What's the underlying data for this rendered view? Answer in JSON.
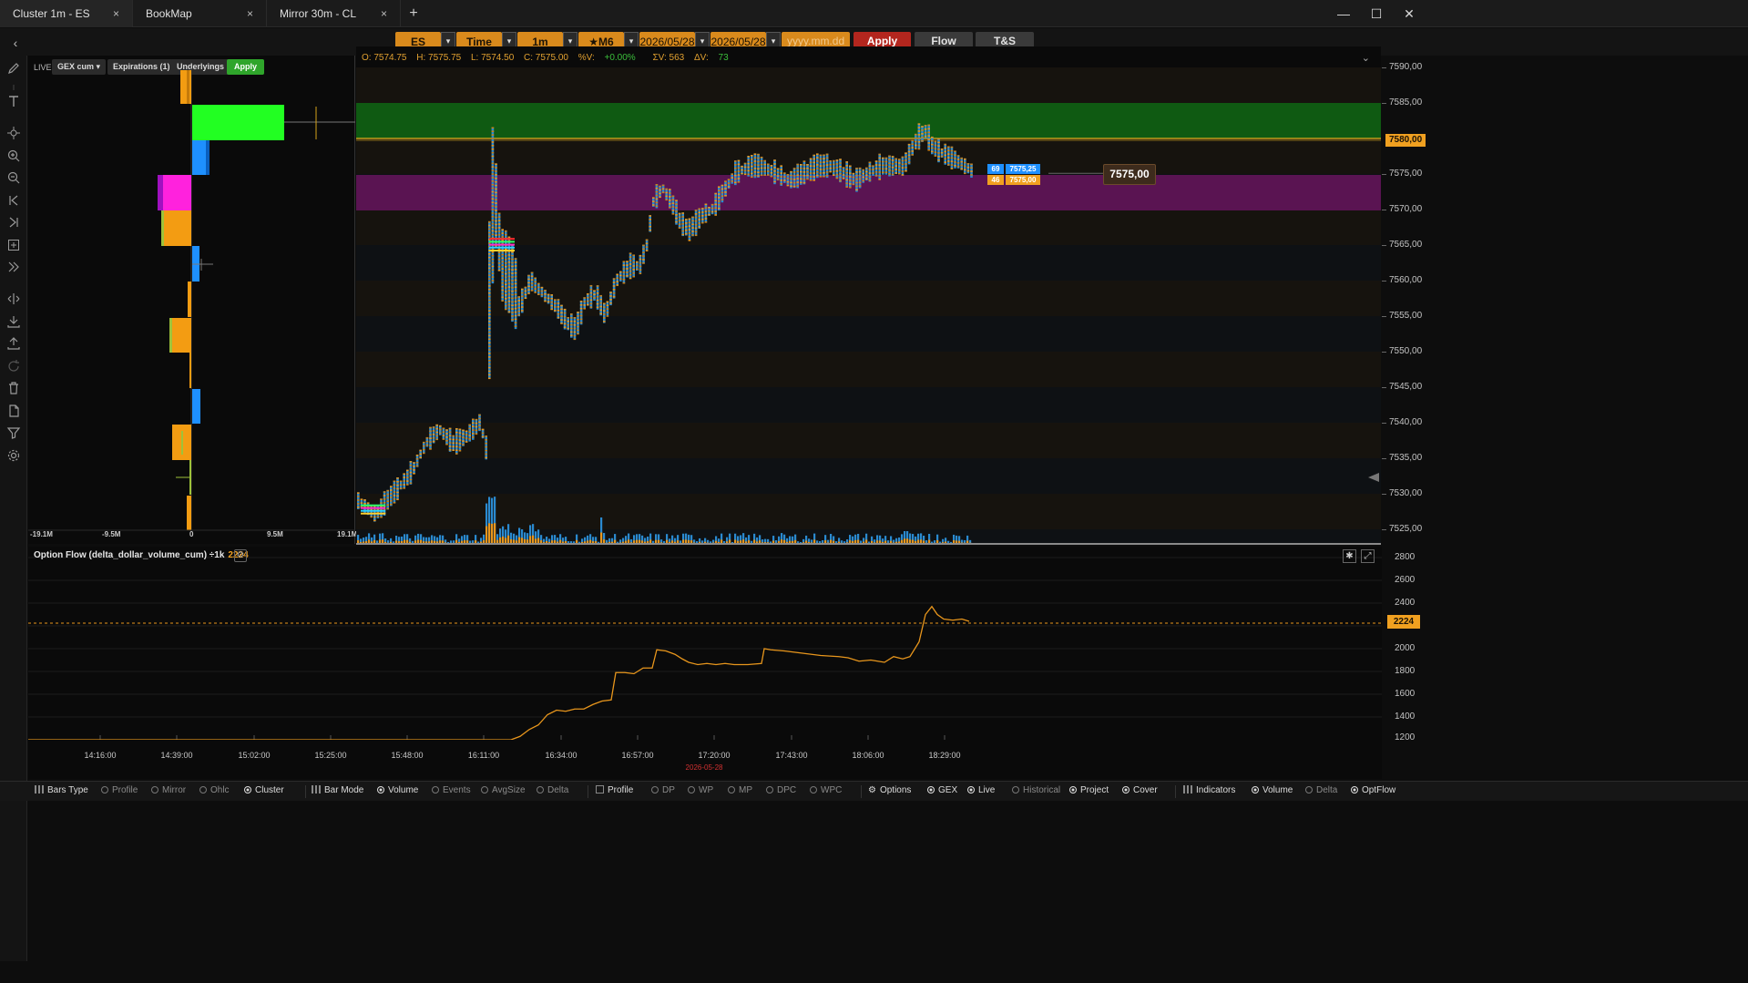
{
  "tabs": [
    {
      "label": "Cluster 1m - ES",
      "active": true
    },
    {
      "label": "BookMap",
      "active": false
    },
    {
      "label": "Mirror 30m - CL",
      "active": false
    }
  ],
  "tab_close_glyph": "×",
  "tab_add_glyph": "+",
  "window_controls": {
    "minimize": "—",
    "maximize": "☐",
    "close": "✕"
  },
  "toolbar": {
    "symbol": "ES",
    "bar_type": "Time",
    "interval": "1m",
    "contract": "★M6",
    "date_from": "2026/05/28",
    "date_to": "2026/05/28",
    "date_placeholder": "yyyy.mm.dd",
    "apply": "Apply",
    "flow": "Flow",
    "ts": "T&S"
  },
  "gex": {
    "live": "LIVE",
    "mode": "GEX cum",
    "expirations": "Expirations",
    "expirations_count": "(1)",
    "underlyings": "Underlyings",
    "apply": "Apply",
    "axis": [
      "-19.1M",
      "-9.5M",
      "0",
      "9.5M",
      "19.1M"
    ]
  },
  "ohlc": {
    "open": "O: 7574.75",
    "high": "H: 7575.75",
    "low": "L: 7574.50",
    "close": "C: 7575.00",
    "pct_label": "%V:",
    "pct_value": "+0.00%",
    "sum_v": "ΣV: 563",
    "delta_label": "ΔV:",
    "delta_value": "73"
  },
  "price_axis": [
    "7590,00",
    "7585,00",
    "7580,00",
    "7575,00",
    "7570,00",
    "7565,00",
    "7560,00",
    "7555,00",
    "7550,00",
    "7545,00",
    "7540,00",
    "7535,00",
    "7530,00",
    "7525,00"
  ],
  "current_price_tag": "7580,00",
  "price_labels": {
    "bid_qty": "69",
    "bid_px": "7575,25",
    "ask_qty": "46",
    "ask_px": "7575,00",
    "last": "7575,00"
  },
  "flow": {
    "title": "Option Flow (delta_dollar_volume_cum) ÷1k",
    "value": "2224",
    "axis": [
      "2800",
      "2600",
      "2400",
      "2200",
      "2000",
      "1800",
      "1600",
      "1400",
      "1200"
    ],
    "current_tag": "2224"
  },
  "time_axis": [
    "14:16:00",
    "14:39:00",
    "15:02:00",
    "15:25:00",
    "15:48:00",
    "16:11:00",
    "16:34:00",
    "16:57:00",
    "17:20:00",
    "17:43:00",
    "18:06:00",
    "18:29:00"
  ],
  "time_date": "2026-05-28",
  "statusbar": [
    {
      "label": "Bars Type",
      "kind": "bars",
      "on": true
    },
    {
      "label": "Profile",
      "kind": "radio",
      "on": false
    },
    {
      "label": "Mirror",
      "kind": "radio",
      "on": false
    },
    {
      "label": "Ohlc",
      "kind": "radio",
      "on": false
    },
    {
      "label": "Cluster",
      "kind": "radio",
      "on": true
    },
    {
      "label": "Bar Mode",
      "kind": "bars",
      "on": true
    },
    {
      "label": "Volume",
      "kind": "radio",
      "on": true
    },
    {
      "label": "Events",
      "kind": "radio",
      "on": false
    },
    {
      "label": "AvgSize",
      "kind": "radio",
      "on": false
    },
    {
      "label": "Delta",
      "kind": "radio",
      "on": false
    },
    {
      "label": "Profile",
      "kind": "square",
      "on": true
    },
    {
      "label": "DP",
      "kind": "radio",
      "on": false
    },
    {
      "label": "WP",
      "kind": "radio",
      "on": false
    },
    {
      "label": "MP",
      "kind": "radio",
      "on": false
    },
    {
      "label": "DPC",
      "kind": "radio",
      "on": false
    },
    {
      "label": "WPC",
      "kind": "radio",
      "on": false
    },
    {
      "label": "Options",
      "kind": "cog",
      "on": true
    },
    {
      "label": "GEX",
      "kind": "radio",
      "on": true
    },
    {
      "label": "Live",
      "kind": "radio",
      "on": true
    },
    {
      "label": "Historical",
      "kind": "radio",
      "on": false
    },
    {
      "label": "Project",
      "kind": "radio",
      "on": true
    },
    {
      "label": "Cover",
      "kind": "radio",
      "on": true
    },
    {
      "label": "Indicators",
      "kind": "bars",
      "on": true
    },
    {
      "label": "Volume",
      "kind": "radio",
      "on": true
    },
    {
      "label": "Delta",
      "kind": "radio",
      "on": false
    },
    {
      "label": "OptFlow",
      "kind": "radio",
      "on": true
    }
  ],
  "colors": {
    "accent_orange": "#f0a020",
    "candle_blue": "#2a8ad0",
    "candle_orange": "#e8961c",
    "gex_green": "#22ff22",
    "gex_magenta": "#ff22dd",
    "gex_blue": "#1e90ff",
    "zone_green": "#0f5a12",
    "zone_purple": "#5a1452",
    "apply_red": "#b3261e"
  },
  "icons": [
    "pencil-icon",
    "text-icon",
    "crosshair-icon",
    "zoom-in-icon",
    "zoom-out-icon",
    "go-start-icon",
    "go-end-icon",
    "add-icon",
    "expand-icon",
    "split-icon",
    "download-icon",
    "upload-icon",
    "refresh-icon",
    "trash-icon",
    "file-icon",
    "filter-icon",
    "settings-icon"
  ]
}
